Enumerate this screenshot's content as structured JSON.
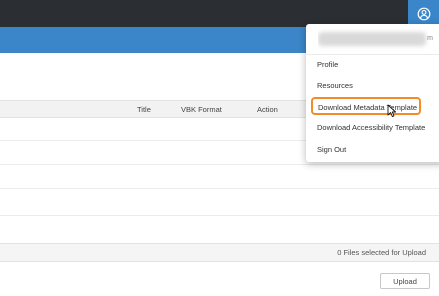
{
  "header": {
    "account_icon": "user-circle-icon"
  },
  "table": {
    "columns": [
      "Title",
      "VBK Format",
      "Action"
    ],
    "rows": [],
    "footer_status": "0 Files selected for Upload"
  },
  "actions": {
    "upload_label": "Upload"
  },
  "dropdown": {
    "user_email_suffix": "m",
    "items": [
      {
        "label": "Profile"
      },
      {
        "label": "Resources"
      },
      {
        "label": "Download Metadata Template"
      },
      {
        "label": "Download Accessibility Template"
      },
      {
        "label": "Sign Out"
      }
    ],
    "highlight_color": "#f28c28"
  },
  "colors": {
    "topbar": "#2b2f33",
    "accent": "#3a86c8"
  }
}
